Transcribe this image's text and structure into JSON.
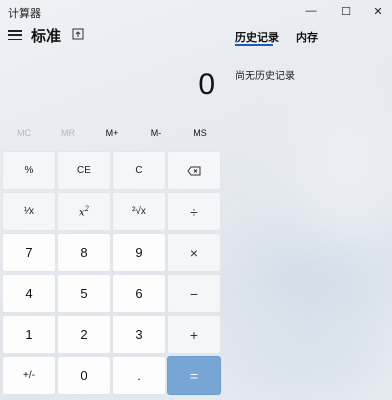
{
  "window": {
    "title": "计算器",
    "controls": {
      "minimize": "—",
      "maximize": "☐",
      "close": "✕"
    }
  },
  "header": {
    "mode": "标准"
  },
  "side_panel": {
    "tabs": [
      {
        "label": "历史记录",
        "active": true
      },
      {
        "label": "内存",
        "active": false
      }
    ],
    "empty_message": "尚无历史记录"
  },
  "display": {
    "value": "0"
  },
  "memory": {
    "buttons": [
      {
        "label": "MC",
        "enabled": false
      },
      {
        "label": "MR",
        "enabled": false
      },
      {
        "label": "M+",
        "enabled": true
      },
      {
        "label": "M-",
        "enabled": true
      },
      {
        "label": "MS",
        "enabled": true
      }
    ]
  },
  "keypad": {
    "percent": "%",
    "ce": "CE",
    "clear": "C",
    "backspace_icon": "backspace-icon",
    "reciprocal": "¹⁄x",
    "square": "x",
    "square_sup": "2",
    "sqrt": "²√x",
    "divide": "÷",
    "seven": "7",
    "eight": "8",
    "nine": "9",
    "multiply": "×",
    "four": "4",
    "five": "5",
    "six": "6",
    "minus": "−",
    "one": "1",
    "two": "2",
    "three": "3",
    "plus": "+",
    "negate": "+/-",
    "zero": "0",
    "decimal": ".",
    "equals": "="
  },
  "colors": {
    "accent": "#1a5fb4",
    "equals_bg": "#77a5d4"
  }
}
